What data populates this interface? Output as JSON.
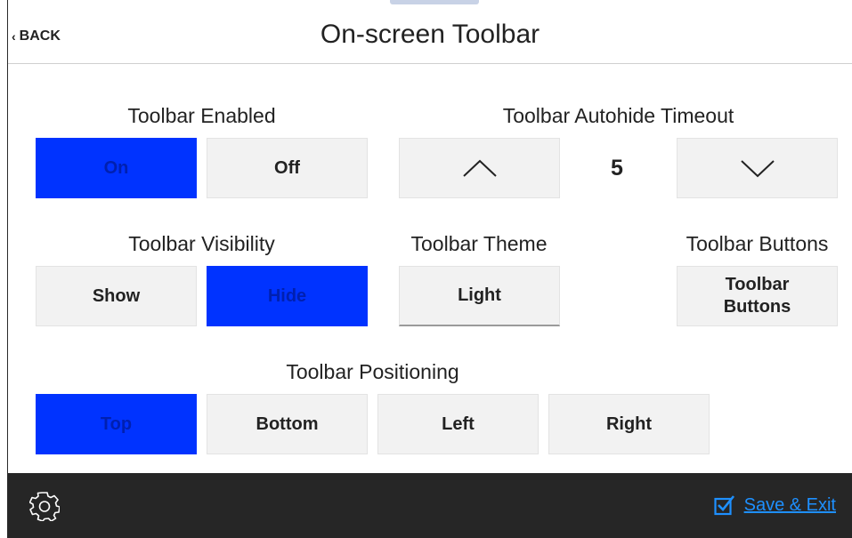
{
  "header": {
    "back_label": "BACK",
    "title": "On-screen Toolbar"
  },
  "toolbar_enabled": {
    "label": "Toolbar Enabled",
    "on_label": "On",
    "off_label": "Off",
    "selected": "On"
  },
  "autohide_timeout": {
    "label": "Toolbar Autohide Timeout",
    "value": "5"
  },
  "visibility": {
    "label": "Toolbar Visibility",
    "show_label": "Show",
    "hide_label": "Hide",
    "selected": "Hide"
  },
  "theme": {
    "label": "Toolbar Theme",
    "value": "Light"
  },
  "buttons": {
    "label": "Toolbar Buttons",
    "button_line1": "Toolbar",
    "button_line2": "Buttons"
  },
  "positioning": {
    "label": "Toolbar Positioning",
    "options": [
      "Top",
      "Bottom",
      "Left",
      "Right"
    ],
    "selected": "Top"
  },
  "footer": {
    "save_label": "Save & Exit"
  },
  "colors": {
    "selected": "#0033ff",
    "footer_bg": "#262626",
    "link": "#1e90ff"
  }
}
